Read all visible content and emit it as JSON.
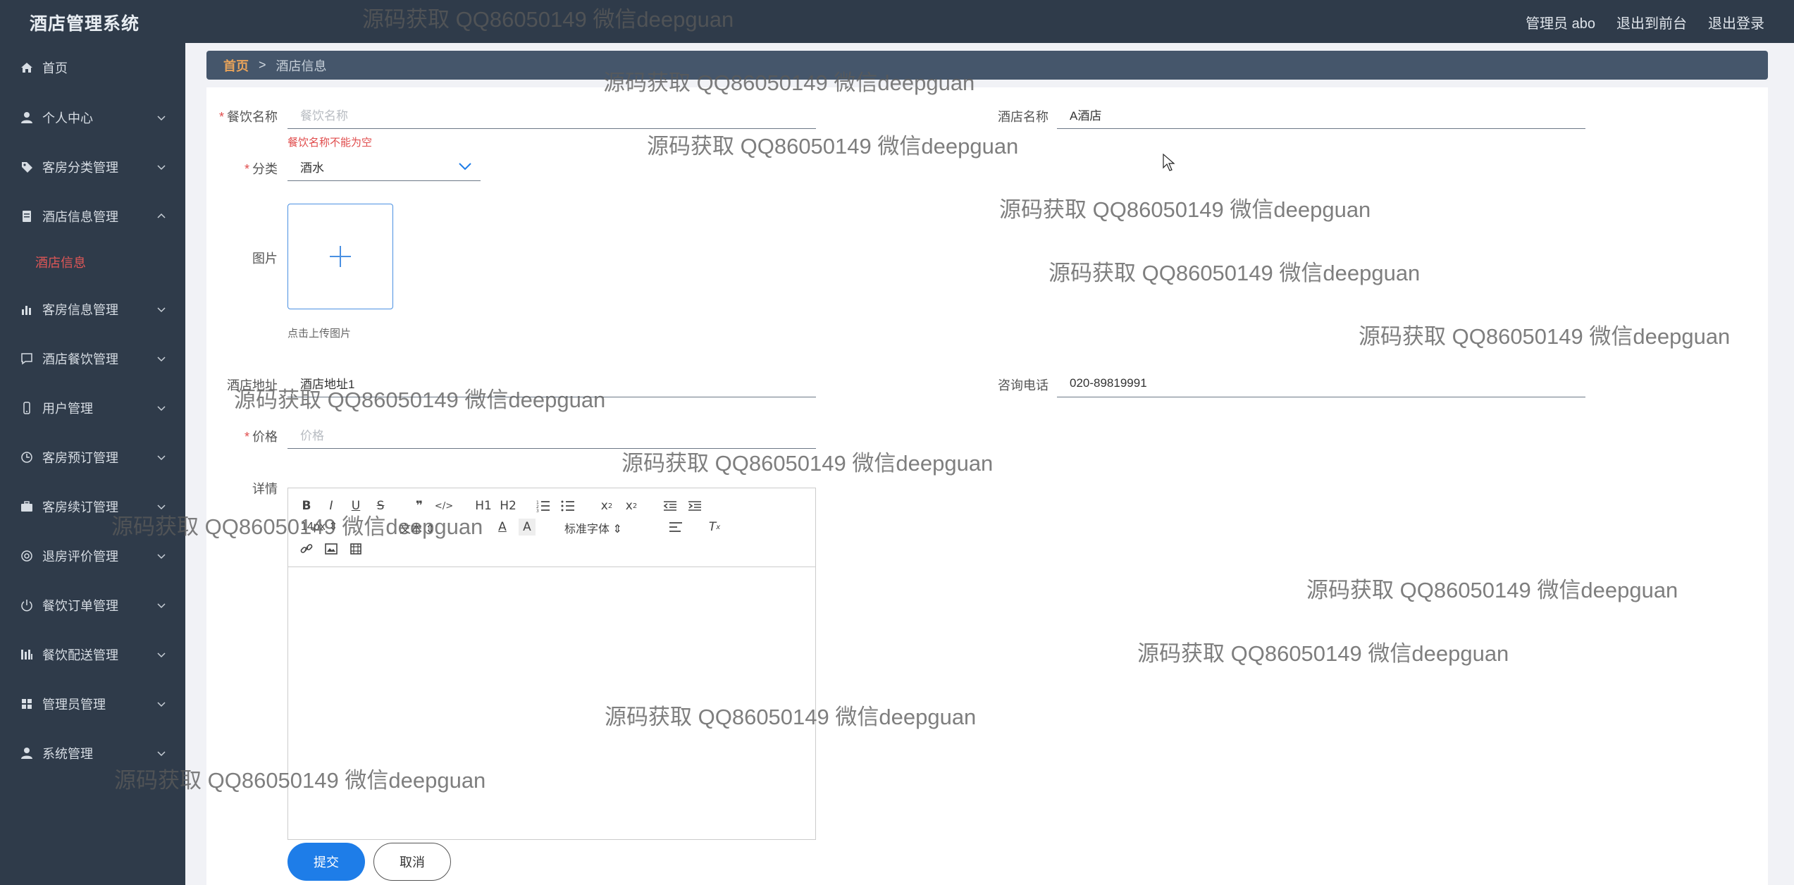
{
  "header": {
    "app_title": "酒店管理系统",
    "admin_label": "管理员 abo",
    "to_front": "退出到前台",
    "logout": "退出登录"
  },
  "sidebar": {
    "items": [
      {
        "label": "首页",
        "icon": "home-icon"
      },
      {
        "label": "个人中心",
        "icon": "user-icon"
      },
      {
        "label": "客房分类管理",
        "icon": "tag-icon"
      },
      {
        "label": "酒店信息管理",
        "icon": "document-icon"
      },
      {
        "label": "客房信息管理",
        "icon": "bar-chart-icon"
      },
      {
        "label": "酒店餐饮管理",
        "icon": "message-icon"
      },
      {
        "label": "用户管理",
        "icon": "phone-icon"
      },
      {
        "label": "客房预订管理",
        "icon": "clock-icon"
      },
      {
        "label": "客房续订管理",
        "icon": "briefcase-icon"
      },
      {
        "label": "退房评价管理",
        "icon": "circle-icon"
      },
      {
        "label": "餐饮订单管理",
        "icon": "power-icon"
      },
      {
        "label": "餐饮配送管理",
        "icon": "stats-icon"
      },
      {
        "label": "管理员管理",
        "icon": "grid-icon"
      },
      {
        "label": "系统管理",
        "icon": "person-icon"
      }
    ],
    "active_sub_item": "酒店信息"
  },
  "breadcrumb": {
    "home": "首页",
    "separator": ">",
    "current": "酒店信息"
  },
  "form": {
    "dining_name_label": "餐饮名称",
    "dining_name_placeholder": "餐饮名称",
    "dining_name_error": "餐饮名称不能为空",
    "hotel_name_label": "酒店名称",
    "hotel_name_value": "A酒店",
    "category_label": "分类",
    "category_value": "酒水",
    "image_label": "图片",
    "upload_hint": "点击上传图片",
    "address_label": "酒店地址",
    "address_value": "酒店地址1",
    "phone_label": "咨询电话",
    "phone_value": "020-89819991",
    "price_label": "价格",
    "price_placeholder": "价格",
    "detail_label": "详情"
  },
  "editor": {
    "font_size": "14px",
    "text_type": "文本",
    "font_family": "标准字体",
    "h1": "H1",
    "h2": "H2"
  },
  "buttons": {
    "submit": "提交",
    "cancel": "取消"
  },
  "watermark": "源码获取 QQ86050149 微信deepguan",
  "colors": {
    "sidebar_bg": "#2f3b4a",
    "breadcrumb_bg": "#45566b",
    "active_sub": "#e05757",
    "primary": "#1e7de8",
    "error": "#e04c4c"
  }
}
